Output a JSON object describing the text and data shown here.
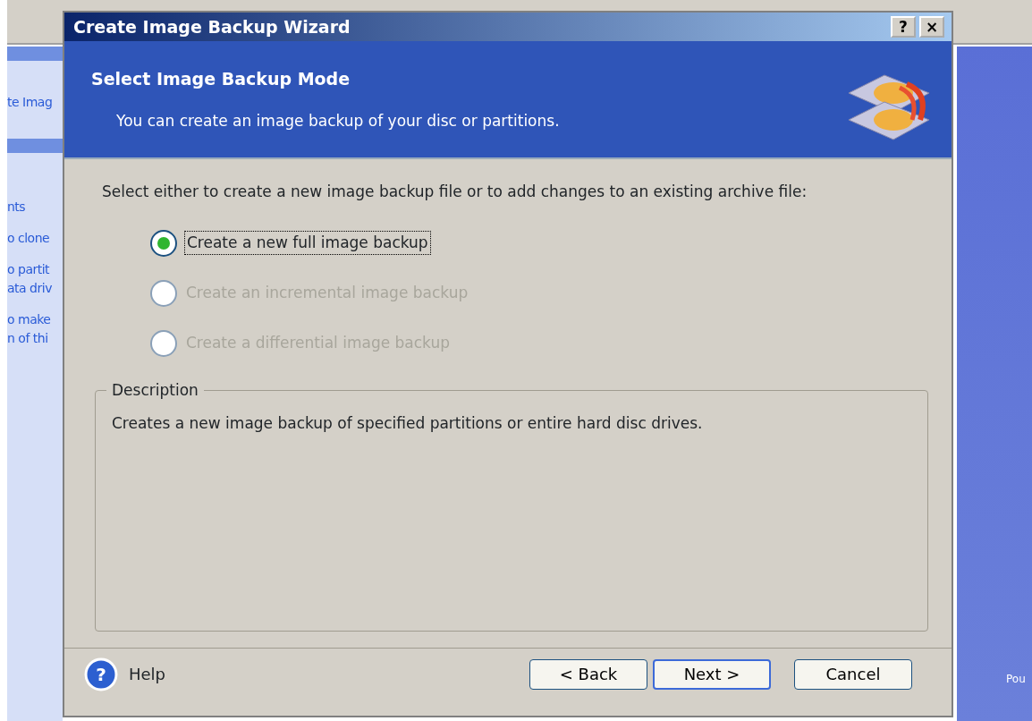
{
  "background_app": {
    "sidebar_items": [
      {
        "text": "te Imag"
      },
      {
        "text": "nts"
      },
      {
        "text": "o clone"
      },
      {
        "text": "o partit\nata driv"
      },
      {
        "text": "o make\nn of thi"
      }
    ],
    "corner_label": "Pou"
  },
  "window": {
    "title": "Create Image Backup Wizard",
    "title_buttons": [
      "?",
      "×"
    ]
  },
  "header": {
    "title": "Select Image Backup Mode",
    "subtitle": "You can create an image backup of your disc or partitions."
  },
  "prompt": "Select either to create a new image backup file or to add changes to an existing archive file:",
  "options": [
    {
      "label": "Create a new full image backup",
      "selected": true,
      "disabled": false
    },
    {
      "label": "Create an incremental image backup",
      "selected": false,
      "disabled": true
    },
    {
      "label": "Create a differential image backup",
      "selected": false,
      "disabled": true
    }
  ],
  "description": {
    "legend": "Description",
    "text": "Creates a new image backup of specified partitions or entire hard disc drives."
  },
  "help_icon": "?",
  "help": "Help",
  "buttons": [
    {
      "label": "< Back",
      "kind": "back"
    },
    {
      "label": "Next >",
      "kind": "next"
    },
    {
      "label": "Cancel",
      "kind": "cancel"
    }
  ]
}
